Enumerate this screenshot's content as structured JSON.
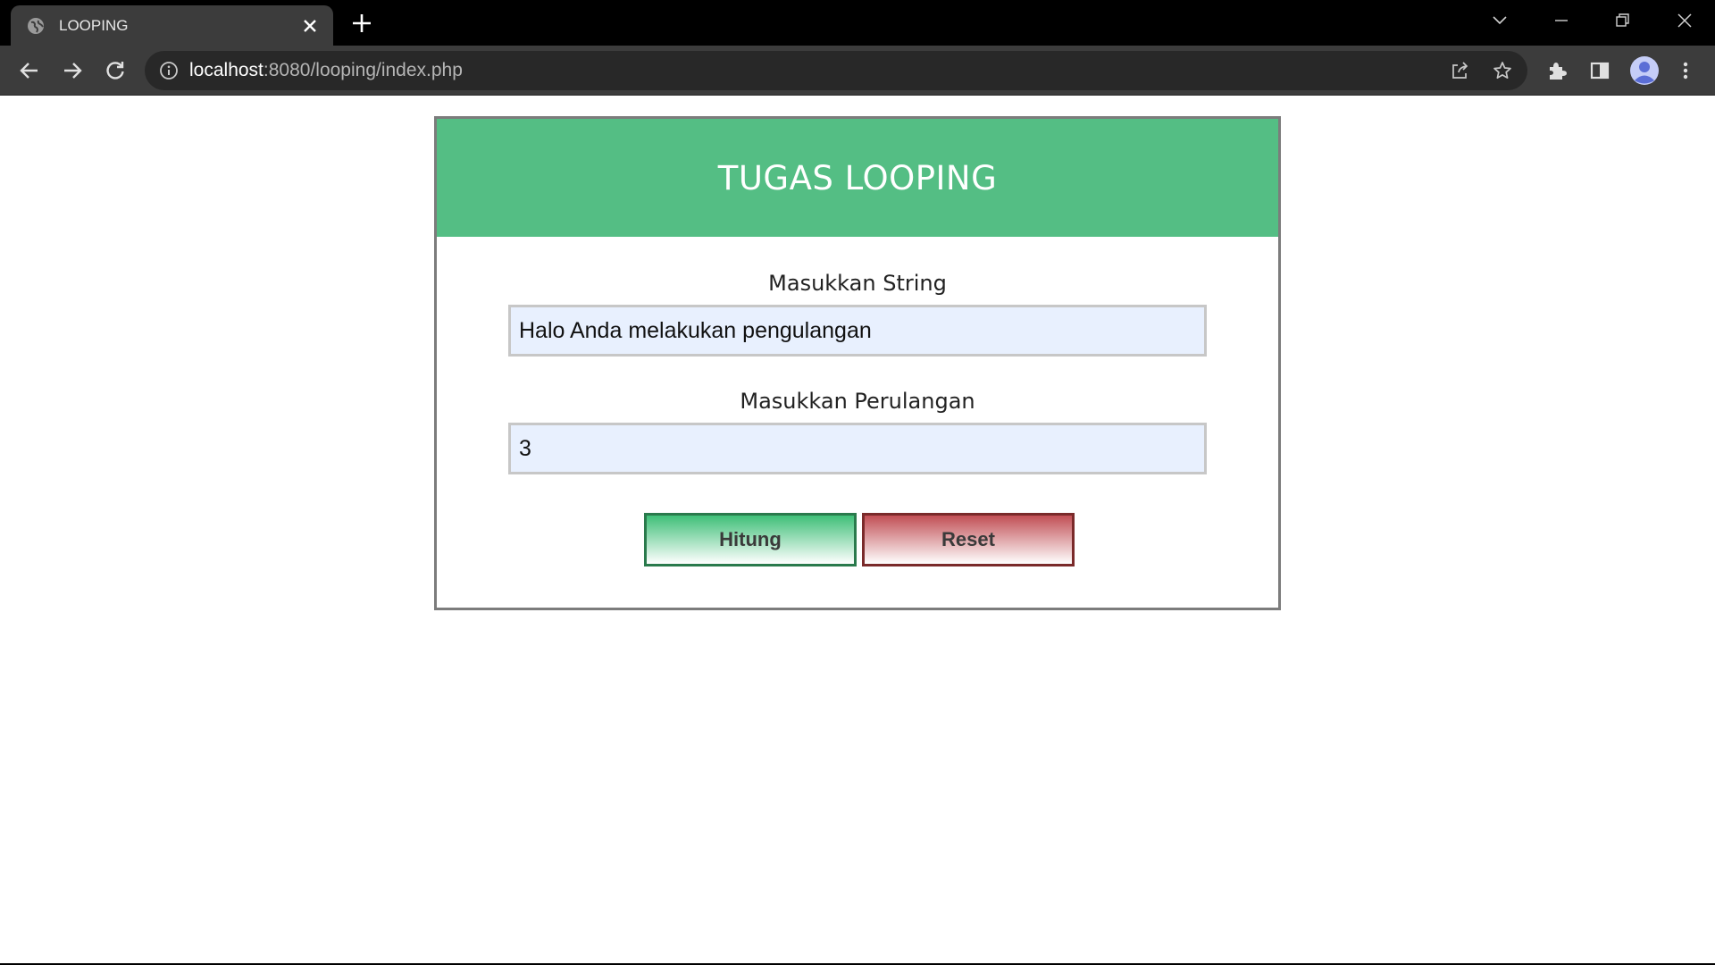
{
  "browser": {
    "tab_title": "LOOPING",
    "url_host": "localhost",
    "url_path": ":8080/looping/index.php"
  },
  "form": {
    "title": "TUGAS LOOPING",
    "string_label": "Masukkan String",
    "string_value": "Halo Anda melakukan pengulangan",
    "loop_label": "Masukkan Perulangan",
    "loop_value": "3",
    "submit_label": "Hitung",
    "reset_label": "Reset"
  },
  "colors": {
    "header": "#54be84",
    "input_bg": "#e8f0fe",
    "hitung_border": "#2a7a4c",
    "reset_border": "#7a2a2a"
  },
  "icons": {
    "tab_favicon": "globe-icon",
    "tab_close": "close-icon",
    "new_tab": "plus-icon",
    "back": "back-arrow-icon",
    "forward": "forward-arrow-icon",
    "reload": "reload-icon",
    "site_info": "info-icon",
    "share": "share-icon",
    "bookmark": "star-icon",
    "extensions": "puzzle-icon",
    "side_panel": "side-panel-icon",
    "profile": "profile-avatar-icon",
    "menu": "kebab-menu-icon"
  }
}
